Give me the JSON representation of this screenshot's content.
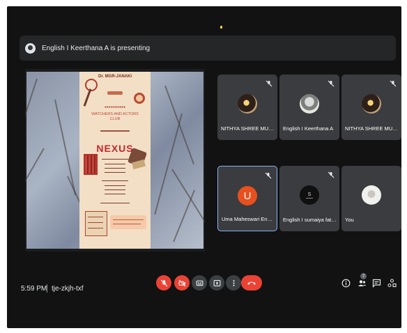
{
  "banner": {
    "text": "English I Keerthana A is presenting"
  },
  "presentation": {
    "poster_header": "Dr. MGR-JANAKI",
    "club_name": "WATCHERS AND ACTORS CLUB",
    "event_name": "NEXUS"
  },
  "participants": [
    {
      "name": "NITHYA SHREE MURALI",
      "avatar_type": "photo-a",
      "muted": true
    },
    {
      "name": "English I Keerthana A",
      "avatar_type": "photo-b",
      "muted": true
    },
    {
      "name": "NITHYA SHREE MURALI",
      "avatar_type": "photo-a",
      "muted": true
    },
    {
      "name": "Uma Maheswari English",
      "avatar_type": "letter",
      "initial": "U",
      "avatar_color": "#e8501e",
      "muted": true,
      "active": true
    },
    {
      "name": "English I sumaiya fathi...",
      "avatar_type": "dark",
      "muted": true
    },
    {
      "name": "You",
      "avatar_type": "photo-c",
      "muted": false
    }
  ],
  "bottom_bar": {
    "time": "5:59 PM",
    "meeting_code": "tje-zkjh-txf",
    "people_count": "7"
  },
  "controls": [
    {
      "name": "mic-off-button",
      "icon": "mic-off-icon",
      "color": "#ea4335"
    },
    {
      "name": "camera-off-button",
      "icon": "videocam-off-icon",
      "color": "#ea4335"
    },
    {
      "name": "captions-button",
      "icon": "closed-caption-icon",
      "color": "#3c4043"
    },
    {
      "name": "present-button",
      "icon": "present-screen-icon",
      "color": "#3c4043"
    },
    {
      "name": "more-options-button",
      "icon": "more-vert-icon",
      "color": "#3c4043"
    },
    {
      "name": "end-call-button",
      "icon": "call-end-icon",
      "color": "#ea4335"
    }
  ],
  "colors": {
    "background": "#121212",
    "tile": "#3b3c3f",
    "active_border": "#8ab4f8",
    "danger": "#ea4335"
  }
}
